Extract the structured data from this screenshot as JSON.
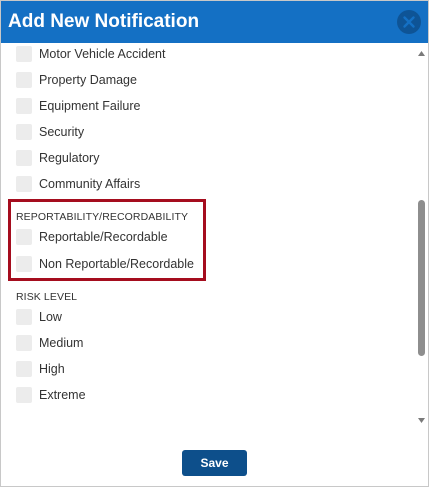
{
  "dialog": {
    "title": "Add New Notification",
    "close_icon": "close-circle-icon"
  },
  "category_items": [
    {
      "label": "Motor Vehicle Accident",
      "checked": false
    },
    {
      "label": "Property Damage",
      "checked": false
    },
    {
      "label": "Equipment Failure",
      "checked": false
    },
    {
      "label": "Security",
      "checked": false
    },
    {
      "label": "Regulatory",
      "checked": false
    },
    {
      "label": "Community Affairs",
      "checked": false
    }
  ],
  "reportability": {
    "header": "REPORTABILITY/RECORDABILITY",
    "items": [
      {
        "label": "Reportable/Recordable",
        "checked": false
      },
      {
        "label": "Non Reportable/Recordable",
        "checked": false
      }
    ]
  },
  "risk_level": {
    "header": "RISK LEVEL",
    "items": [
      {
        "label": "Low",
        "checked": false
      },
      {
        "label": "Medium",
        "checked": false
      },
      {
        "label": "High",
        "checked": false
      },
      {
        "label": "Extreme",
        "checked": false
      }
    ]
  },
  "footer": {
    "save_label": "Save"
  },
  "colors": {
    "titlebar": "#1470c4",
    "close_button": "#0e5496",
    "highlight_border": "#a50d1e",
    "save_button": "#0d4f8b",
    "checkbox": "#ececec"
  }
}
